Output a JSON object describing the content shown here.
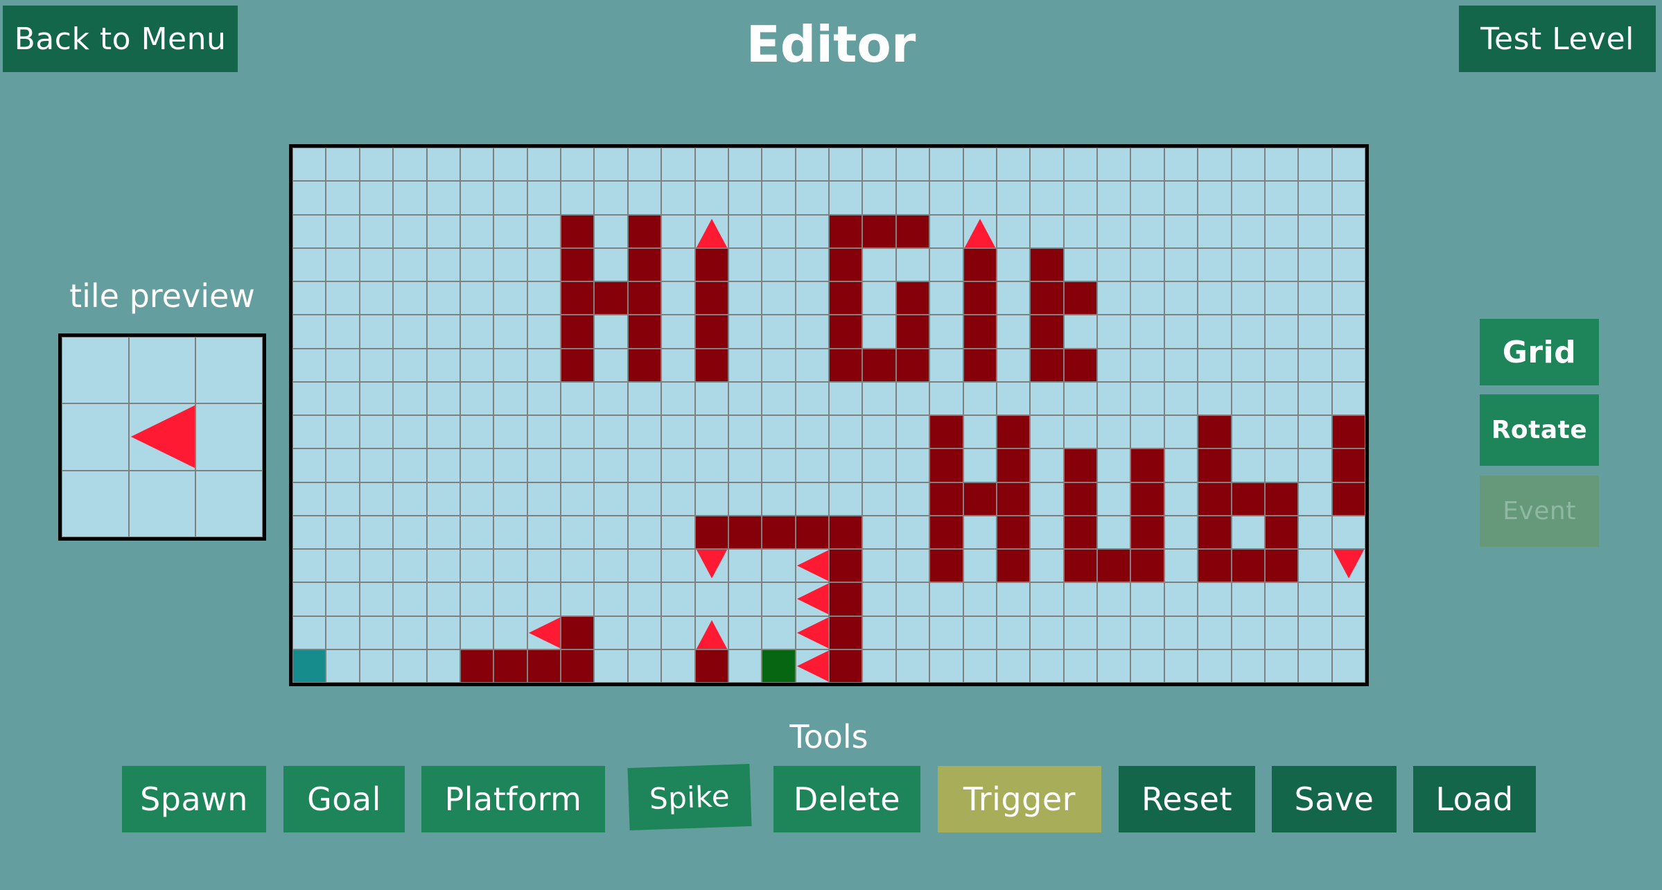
{
  "header": {
    "back_label": "Back to Menu",
    "title": "Editor",
    "test_label": "Test Level"
  },
  "preview": {
    "label": "tile preview",
    "spike_direction": "left"
  },
  "side_tools": {
    "grid_label": "Grid",
    "rotate_label": "Rotate",
    "event_label": "Event"
  },
  "tools": {
    "heading": "Tools",
    "buttons": [
      {
        "label": "Spawn",
        "state": "normal"
      },
      {
        "label": "Goal",
        "state": "normal"
      },
      {
        "label": "Platform",
        "state": "normal"
      },
      {
        "label": "Spike",
        "state": "selected"
      },
      {
        "label": "Delete",
        "state": "normal"
      },
      {
        "label": "Trigger",
        "state": "highlight"
      },
      {
        "label": "Reset",
        "state": "action"
      },
      {
        "label": "Save",
        "state": "action"
      },
      {
        "label": "Load",
        "state": "action"
      }
    ]
  },
  "colors": {
    "background": "#659e9e",
    "button_dark": "#14664a",
    "button_mid": "#1e8459",
    "trigger": "#a8ad5a",
    "event_disabled": "#659979",
    "grid_empty": "#add8e6",
    "grid_line": "#808080",
    "wall": "#850008",
    "spike": "#ff1a33",
    "spawn": "#178c8c",
    "goal": "#076611"
  },
  "level": {
    "columns": 32,
    "rows": 16,
    "tiles": [
      {
        "row": 2,
        "col": 8,
        "type": "wall"
      },
      {
        "row": 2,
        "col": 10,
        "type": "wall"
      },
      {
        "row": 2,
        "col": 12,
        "type": "spike",
        "dir": "up"
      },
      {
        "row": 2,
        "col": 16,
        "type": "wall"
      },
      {
        "row": 2,
        "col": 17,
        "type": "wall"
      },
      {
        "row": 2,
        "col": 18,
        "type": "wall"
      },
      {
        "row": 2,
        "col": 20,
        "type": "spike",
        "dir": "up"
      },
      {
        "row": 3,
        "col": 8,
        "type": "wall"
      },
      {
        "row": 3,
        "col": 10,
        "type": "wall"
      },
      {
        "row": 3,
        "col": 12,
        "type": "wall"
      },
      {
        "row": 3,
        "col": 16,
        "type": "wall"
      },
      {
        "row": 3,
        "col": 20,
        "type": "wall"
      },
      {
        "row": 3,
        "col": 22,
        "type": "wall"
      },
      {
        "row": 4,
        "col": 8,
        "type": "wall"
      },
      {
        "row": 4,
        "col": 9,
        "type": "wall"
      },
      {
        "row": 4,
        "col": 10,
        "type": "wall"
      },
      {
        "row": 4,
        "col": 12,
        "type": "wall"
      },
      {
        "row": 4,
        "col": 16,
        "type": "wall"
      },
      {
        "row": 4,
        "col": 18,
        "type": "wall"
      },
      {
        "row": 4,
        "col": 20,
        "type": "wall"
      },
      {
        "row": 4,
        "col": 22,
        "type": "wall"
      },
      {
        "row": 4,
        "col": 23,
        "type": "wall"
      },
      {
        "row": 5,
        "col": 8,
        "type": "wall"
      },
      {
        "row": 5,
        "col": 10,
        "type": "wall"
      },
      {
        "row": 5,
        "col": 12,
        "type": "wall"
      },
      {
        "row": 5,
        "col": 16,
        "type": "wall"
      },
      {
        "row": 5,
        "col": 18,
        "type": "wall"
      },
      {
        "row": 5,
        "col": 20,
        "type": "wall"
      },
      {
        "row": 5,
        "col": 22,
        "type": "wall"
      },
      {
        "row": 6,
        "col": 8,
        "type": "wall"
      },
      {
        "row": 6,
        "col": 10,
        "type": "wall"
      },
      {
        "row": 6,
        "col": 12,
        "type": "wall"
      },
      {
        "row": 6,
        "col": 16,
        "type": "wall"
      },
      {
        "row": 6,
        "col": 17,
        "type": "wall"
      },
      {
        "row": 6,
        "col": 18,
        "type": "wall"
      },
      {
        "row": 6,
        "col": 20,
        "type": "wall"
      },
      {
        "row": 6,
        "col": 22,
        "type": "wall"
      },
      {
        "row": 6,
        "col": 23,
        "type": "wall"
      },
      {
        "row": 8,
        "col": 19,
        "type": "wall"
      },
      {
        "row": 8,
        "col": 21,
        "type": "wall"
      },
      {
        "row": 8,
        "col": 27,
        "type": "wall"
      },
      {
        "row": 8,
        "col": 31,
        "type": "wall"
      },
      {
        "row": 9,
        "col": 19,
        "type": "wall"
      },
      {
        "row": 9,
        "col": 21,
        "type": "wall"
      },
      {
        "row": 9,
        "col": 23,
        "type": "wall"
      },
      {
        "row": 9,
        "col": 25,
        "type": "wall"
      },
      {
        "row": 9,
        "col": 27,
        "type": "wall"
      },
      {
        "row": 9,
        "col": 31,
        "type": "wall"
      },
      {
        "row": 10,
        "col": 19,
        "type": "wall"
      },
      {
        "row": 10,
        "col": 20,
        "type": "wall"
      },
      {
        "row": 10,
        "col": 21,
        "type": "wall"
      },
      {
        "row": 10,
        "col": 23,
        "type": "wall"
      },
      {
        "row": 10,
        "col": 25,
        "type": "wall"
      },
      {
        "row": 10,
        "col": 27,
        "type": "wall"
      },
      {
        "row": 10,
        "col": 28,
        "type": "wall"
      },
      {
        "row": 10,
        "col": 29,
        "type": "wall"
      },
      {
        "row": 10,
        "col": 31,
        "type": "wall"
      },
      {
        "row": 11,
        "col": 12,
        "type": "wall"
      },
      {
        "row": 11,
        "col": 13,
        "type": "wall"
      },
      {
        "row": 11,
        "col": 14,
        "type": "wall"
      },
      {
        "row": 11,
        "col": 15,
        "type": "wall"
      },
      {
        "row": 11,
        "col": 16,
        "type": "wall"
      },
      {
        "row": 11,
        "col": 19,
        "type": "wall"
      },
      {
        "row": 11,
        "col": 21,
        "type": "wall"
      },
      {
        "row": 11,
        "col": 23,
        "type": "wall"
      },
      {
        "row": 11,
        "col": 25,
        "type": "wall"
      },
      {
        "row": 11,
        "col": 27,
        "type": "wall"
      },
      {
        "row": 11,
        "col": 29,
        "type": "wall"
      },
      {
        "row": 12,
        "col": 12,
        "type": "spike",
        "dir": "down"
      },
      {
        "row": 12,
        "col": 15,
        "type": "spike",
        "dir": "left"
      },
      {
        "row": 12,
        "col": 16,
        "type": "wall"
      },
      {
        "row": 12,
        "col": 19,
        "type": "wall"
      },
      {
        "row": 12,
        "col": 21,
        "type": "wall"
      },
      {
        "row": 12,
        "col": 23,
        "type": "wall"
      },
      {
        "row": 12,
        "col": 24,
        "type": "wall"
      },
      {
        "row": 12,
        "col": 25,
        "type": "wall"
      },
      {
        "row": 12,
        "col": 27,
        "type": "wall"
      },
      {
        "row": 12,
        "col": 28,
        "type": "wall"
      },
      {
        "row": 12,
        "col": 29,
        "type": "wall"
      },
      {
        "row": 12,
        "col": 31,
        "type": "spike",
        "dir": "down"
      },
      {
        "row": 13,
        "col": 15,
        "type": "spike",
        "dir": "left"
      },
      {
        "row": 13,
        "col": 16,
        "type": "wall"
      },
      {
        "row": 14,
        "col": 7,
        "type": "spike",
        "dir": "left"
      },
      {
        "row": 14,
        "col": 8,
        "type": "wall"
      },
      {
        "row": 14,
        "col": 12,
        "type": "spike",
        "dir": "up"
      },
      {
        "row": 14,
        "col": 15,
        "type": "spike",
        "dir": "left"
      },
      {
        "row": 14,
        "col": 16,
        "type": "wall"
      },
      {
        "row": 15,
        "col": 0,
        "type": "spawn"
      },
      {
        "row": 15,
        "col": 5,
        "type": "wall"
      },
      {
        "row": 15,
        "col": 6,
        "type": "wall"
      },
      {
        "row": 15,
        "col": 7,
        "type": "wall"
      },
      {
        "row": 15,
        "col": 8,
        "type": "wall"
      },
      {
        "row": 15,
        "col": 12,
        "type": "wall"
      },
      {
        "row": 15,
        "col": 14,
        "type": "goal"
      },
      {
        "row": 15,
        "col": 15,
        "type": "spike",
        "dir": "left"
      },
      {
        "row": 15,
        "col": 16,
        "type": "wall"
      }
    ]
  }
}
